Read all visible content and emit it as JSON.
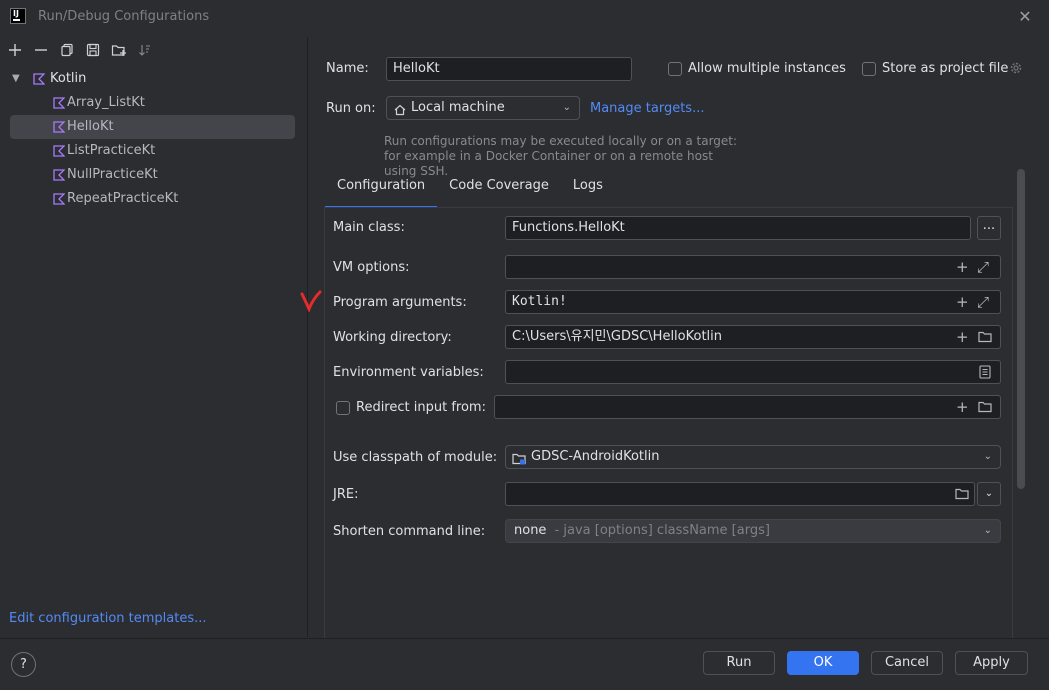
{
  "window": {
    "title": "Run/Debug Configurations",
    "app_icon": "IJ"
  },
  "toolbar": {
    "icons": [
      "add-icon",
      "remove-icon",
      "copy-icon",
      "save-icon",
      "folder-add-icon",
      "sort-icon"
    ]
  },
  "tree": {
    "root": {
      "label": "Kotlin",
      "expanded": true
    },
    "items": [
      {
        "label": "Array_ListKt"
      },
      {
        "label": "HelloKt",
        "selected": true
      },
      {
        "label": "ListPracticeKt"
      },
      {
        "label": "NullPracticeKt"
      },
      {
        "label": "RepeatPracticeKt"
      }
    ]
  },
  "edit_templates_link": "Edit configuration templates...",
  "form": {
    "name_label": "Name:",
    "name_value": "HelloKt",
    "allow_multiple_label": "Allow multiple instances",
    "store_as_project_label": "Store as project file",
    "run_on_label": "Run on:",
    "run_on_value": "Local machine",
    "manage_targets": "Manage targets...",
    "hint": "Run configurations may be executed locally or on a target: for example in a Docker Container or on a remote host using SSH."
  },
  "tabs": [
    {
      "label": "Configuration",
      "active": true
    },
    {
      "label": "Code Coverage"
    },
    {
      "label": "Logs"
    }
  ],
  "config": {
    "main_class_label": "Main class:",
    "main_class_value": "Functions.HelloKt",
    "browse_label": "...",
    "vm_options_label": "VM options:",
    "vm_options_value": "",
    "program_args_label": "Program arguments:",
    "program_args_value": "Kotlin!",
    "working_dir_label": "Working directory:",
    "working_dir_value": "C:\\Users\\유지민\\GDSC\\HelloKotlin",
    "env_vars_label": "Environment variables:",
    "env_vars_value": "",
    "redirect_label": "Redirect input from:",
    "redirect_value": "",
    "classpath_label": "Use classpath of module:",
    "classpath_value": "GDSC-AndroidKotlin",
    "jre_label": "JRE:",
    "jre_value": "",
    "shorten_label": "Shorten command line:",
    "shorten_value": "none",
    "shorten_hint": "- java [options] className [args]"
  },
  "buttons": {
    "help": "?",
    "run": "Run",
    "ok": "OK",
    "cancel": "Cancel",
    "apply": "Apply"
  },
  "colors": {
    "accent": "#3574f0",
    "link": "#548af7",
    "kotlin_icon": "#a77bfa",
    "annotation": "#e52b2b"
  }
}
